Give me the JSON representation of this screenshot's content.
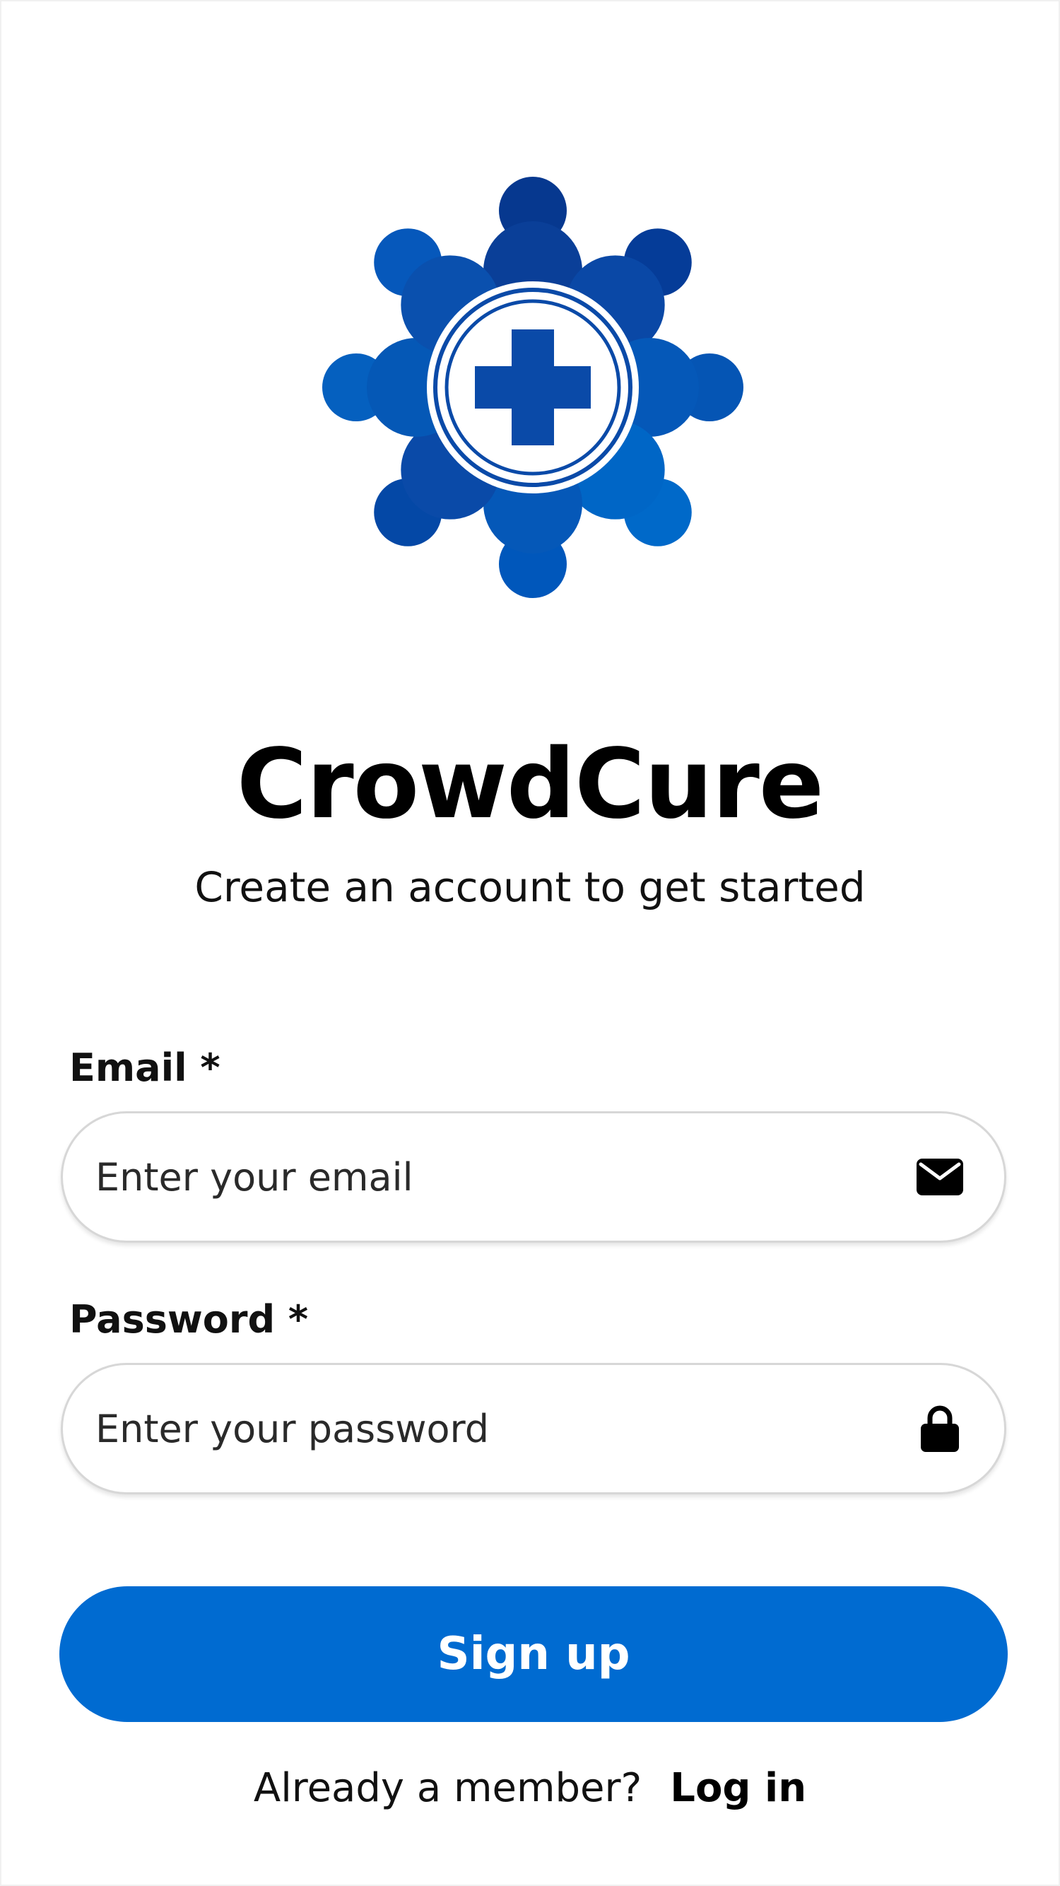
{
  "app": {
    "name": "CrowdCure",
    "subtitle": "Create an account to get started",
    "logo_icon": "crowd-medical-cross-logo",
    "brand_colors": [
      "#003a8c",
      "#0052b0",
      "#0063c7",
      "#006bd1"
    ]
  },
  "form": {
    "email": {
      "label": "Email *",
      "placeholder": "Enter your email",
      "value": "",
      "icon": "envelope-icon"
    },
    "password": {
      "label": "Password *",
      "placeholder": "Enter your password",
      "value": "",
      "icon": "lock-icon"
    },
    "submit_label": "Sign up",
    "submit_color": "#006bd1"
  },
  "footer": {
    "prompt": "Already a member?",
    "link_label": "Log in"
  }
}
